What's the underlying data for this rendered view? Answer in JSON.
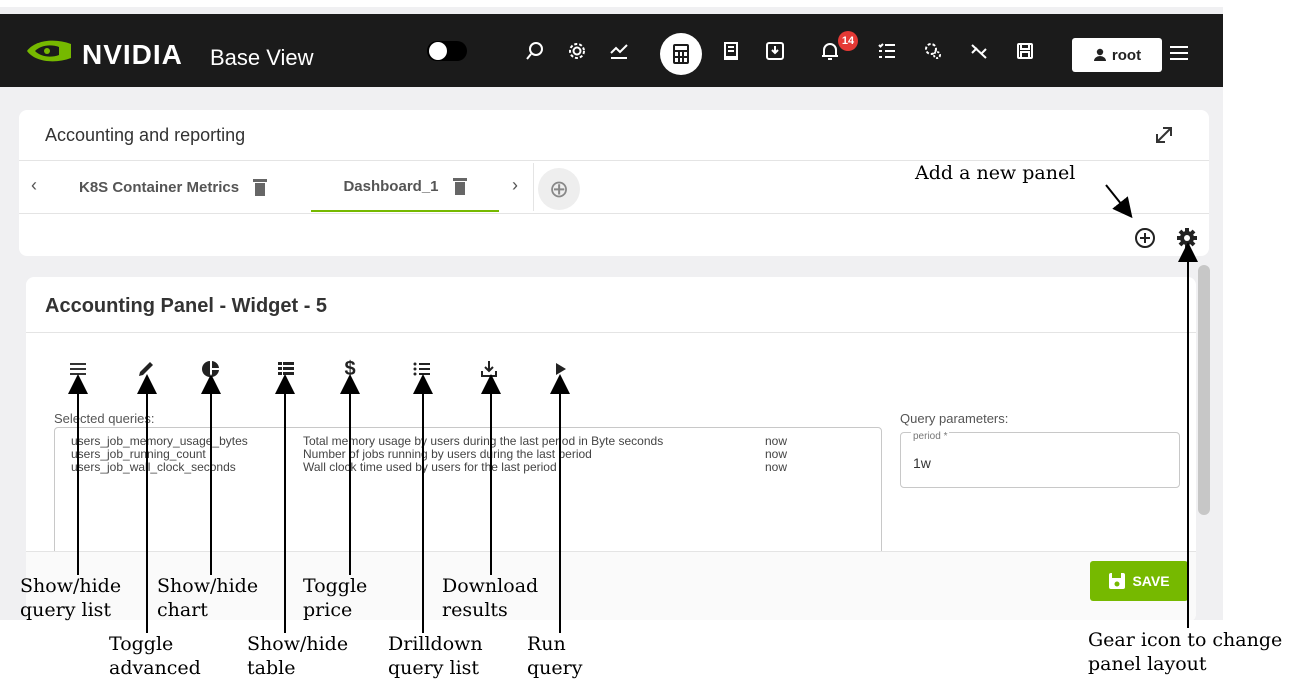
{
  "topbar": {
    "brand": "NVIDIA",
    "brand_suffix": "Base View",
    "notification_count": "14",
    "user": "root",
    "icons": [
      "theme-toggle",
      "moon-icon",
      "search-icon",
      "settings-icon",
      "chart-icon",
      "calculator-icon",
      "document-icon",
      "download-icon",
      "bell-icon",
      "list-icon",
      "gears-icon",
      "link-off-icon",
      "save-icon",
      "menu-icon"
    ]
  },
  "accounting": {
    "title": "Accounting and reporting",
    "tabs": [
      {
        "label": "K8S Container Metrics",
        "active": false
      },
      {
        "label": "Dashboard_1",
        "active": true
      }
    ]
  },
  "widget": {
    "title": "Accounting Panel - Widget - 5",
    "selected_label": "Selected queries:",
    "queries": [
      {
        "name": "users_job_memory_usage_bytes",
        "desc": "Total memory usage by users during the last period in Byte seconds",
        "when": "now"
      },
      {
        "name": "users_job_running_count",
        "desc": "Number of jobs running by users during the last period",
        "when": "now"
      },
      {
        "name": "users_job_wall_clock_seconds",
        "desc": "Wall clock time used by users for the last period",
        "when": "now"
      }
    ],
    "params_label": "Query parameters:",
    "period_label": "period *",
    "period_value": "1w",
    "save_label": "SAVE"
  },
  "annotations": {
    "add_panel": "Add a new panel",
    "show_hide_query_1": "Show/hide",
    "show_hide_query_2": "query list",
    "toggle_adv_1": "Toggle",
    "toggle_adv_2": "advanced",
    "show_hide_chart_1": "Show/hide",
    "show_hide_chart_2": "chart",
    "show_hide_table_1": "Show/hide",
    "show_hide_table_2": "table",
    "toggle_price_1": "Toggle",
    "toggle_price_2": "price",
    "drilldown_1": "Drilldown",
    "drilldown_2": "query list",
    "download_1": "Download",
    "download_2": "results",
    "run_1": "Run",
    "run_2": "query",
    "gear_1": "Gear icon to change",
    "gear_2": "panel layout"
  },
  "colors": {
    "accent": "#76b900",
    "topbar": "#1b1b1b",
    "badge": "#e53935"
  }
}
